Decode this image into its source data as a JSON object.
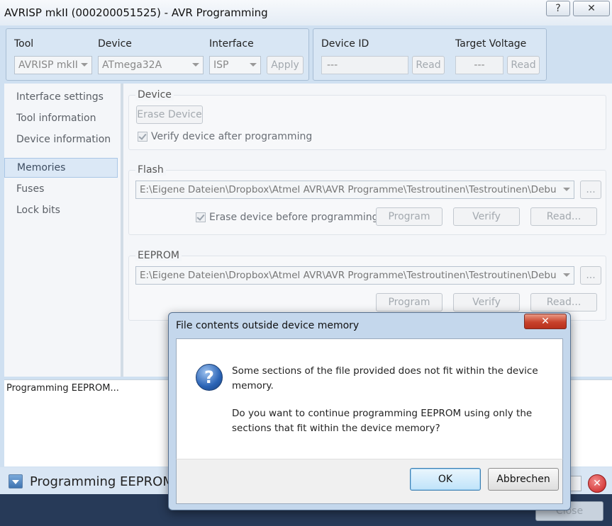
{
  "window": {
    "title": "AVRISP mkII (000200051525) - AVR Programming",
    "help_label": "?",
    "close_label": "✕"
  },
  "toolbar": {
    "tool_label": "Tool",
    "tool_value": "AVRISP mkII",
    "device_label": "Device",
    "device_value": "ATmega32A",
    "interface_label": "Interface",
    "interface_value": "ISP",
    "apply_label": "Apply",
    "device_id_label": "Device ID",
    "device_id_value": "---",
    "device_id_read": "Read",
    "target_voltage_label": "Target Voltage",
    "target_voltage_value": "---",
    "target_voltage_read": "Read"
  },
  "nav": {
    "items": [
      {
        "label": "Interface settings"
      },
      {
        "label": "Tool information"
      },
      {
        "label": "Device information"
      },
      {
        "label": "Memories"
      },
      {
        "label": "Fuses"
      },
      {
        "label": "Lock bits"
      }
    ],
    "selected": "Memories"
  },
  "device_section": {
    "caption": "Device",
    "erase_button": "Erase Device",
    "verify_label": "Verify device after programming"
  },
  "flash_section": {
    "caption": "Flash",
    "path": "E:\\Eigene Dateien\\Dropbox\\Atmel AVR\\AVR Programme\\Testroutinen\\Testroutinen\\Debu",
    "browse": "...",
    "erase_label": "Erase device before programming",
    "program": "Program",
    "verify": "Verify",
    "read": "Read..."
  },
  "eeprom_section": {
    "caption": "EEPROM",
    "path": "E:\\Eigene Dateien\\Dropbox\\Atmel AVR\\AVR Programme\\Testroutinen\\Testroutinen\\Debu",
    "browse": "...",
    "program": "Program",
    "verify": "Verify",
    "read": "Read..."
  },
  "output": {
    "text": "Programming EEPROM..."
  },
  "status": {
    "text": "Programming EEPROM...",
    "cancel_icon": "✕"
  },
  "footer": {
    "close_button": "Close"
  },
  "dialog": {
    "title": "File contents outside device memory",
    "close_label": "✕",
    "icon": "?",
    "message_1": "Some sections of the file provided does not  fit within the device memory.",
    "message_2": "Do you want to continue programming EEPROM using only the sections that fit within the device memory?",
    "ok": "OK",
    "cancel": "Abbrechen"
  }
}
